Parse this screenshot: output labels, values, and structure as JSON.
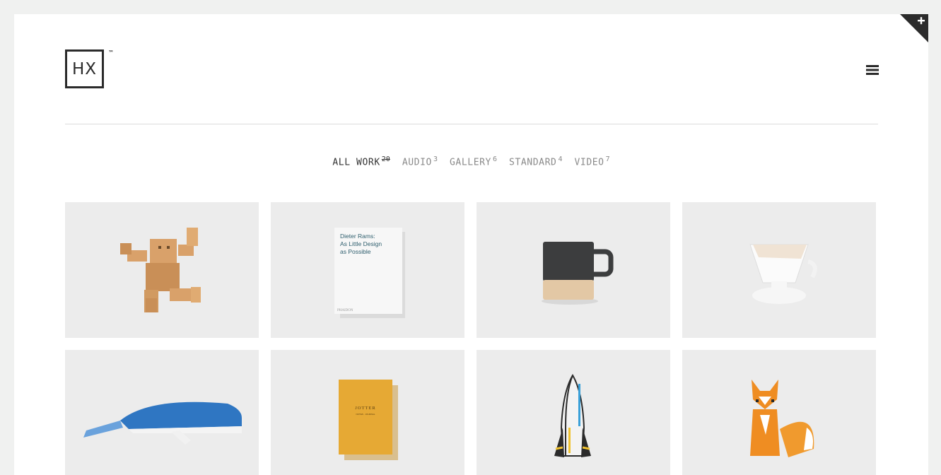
{
  "logo": {
    "text": "HX",
    "tm": "™"
  },
  "menu": {
    "icon": "hamburger-menu-icon"
  },
  "filters": [
    {
      "label": "ALL WORK",
      "count": "20",
      "active": true
    },
    {
      "label": "AUDIO",
      "count": "3",
      "active": false
    },
    {
      "label": "GALLERY",
      "count": "6",
      "active": false
    },
    {
      "label": "STANDARD",
      "count": "4",
      "active": false
    },
    {
      "label": "VIDEO",
      "count": "7",
      "active": false
    }
  ],
  "portfolio": [
    {
      "name": "wooden-robot"
    },
    {
      "name": "book",
      "title_lines": [
        "Dieter Rams:",
        "As Little Design",
        "as Possible"
      ],
      "publisher": "PHAIDON"
    },
    {
      "name": "coffee-mug"
    },
    {
      "name": "coffee-dripper"
    },
    {
      "name": "paper-whale"
    },
    {
      "name": "notebook",
      "title": "JOTTER",
      "subtitle": "NOTES · JOURNAL"
    },
    {
      "name": "paper-rocket"
    },
    {
      "name": "paper-fox"
    }
  ],
  "colors": {
    "accent_dark": "#2b2b2b",
    "tile_bg": "#ececec",
    "page_bg": "#f0f1f0"
  }
}
